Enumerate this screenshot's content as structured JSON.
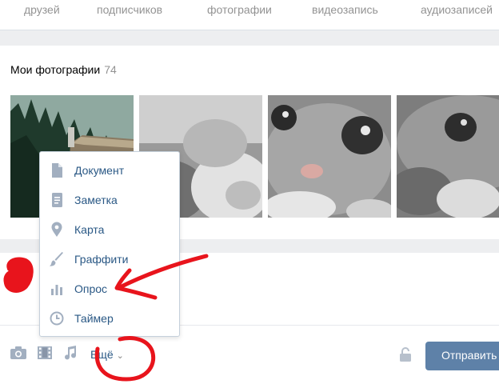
{
  "counters": [
    "друзей",
    "подписчиков",
    "фотографии",
    "видеозапись",
    "аудиозаписей"
  ],
  "photos": {
    "title": "Мои фотографии",
    "count": "74"
  },
  "menu": {
    "items": [
      {
        "label": "Документ",
        "icon": "document-icon"
      },
      {
        "label": "Заметка",
        "icon": "note-icon"
      },
      {
        "label": "Карта",
        "icon": "map-pin-icon"
      },
      {
        "label": "Граффити",
        "icon": "brush-icon"
      },
      {
        "label": "Опрос",
        "icon": "poll-icon"
      },
      {
        "label": "Таймер",
        "icon": "clock-icon"
      }
    ]
  },
  "composer": {
    "more_label": "Ещё",
    "send_label": "Отправить",
    "tools": [
      "camera-icon",
      "video-icon",
      "music-icon"
    ]
  },
  "colors": {
    "link": "#2a5885",
    "muted": "#939393",
    "button": "#5e81a8",
    "annotation": "#e8141c"
  }
}
